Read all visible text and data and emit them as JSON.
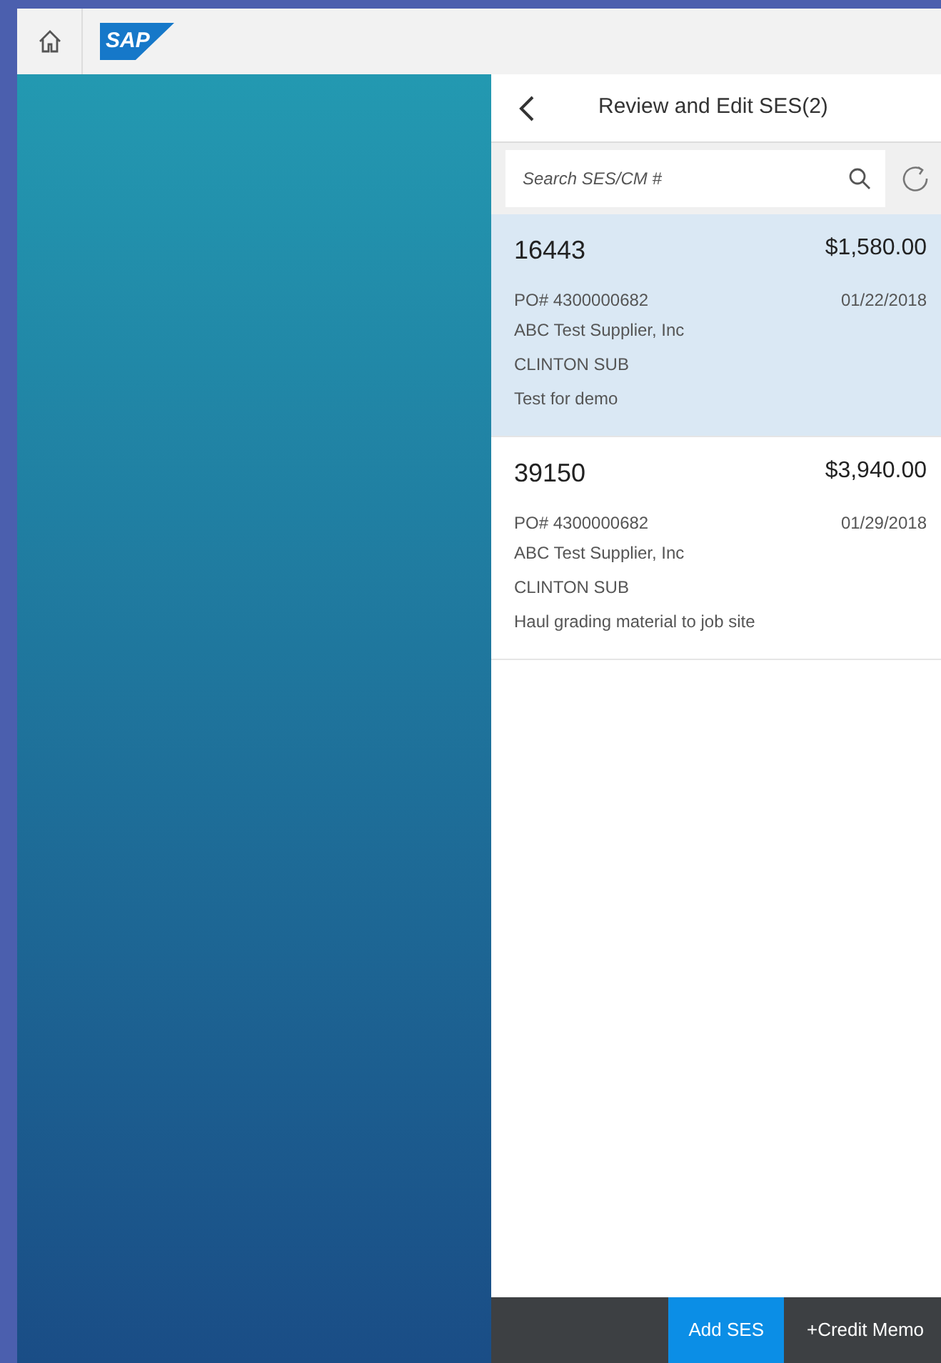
{
  "header": {
    "logo_text": "SAP"
  },
  "panel": {
    "title": "Review and Edit SES(2)",
    "search": {
      "placeholder": "Search SES/CM #"
    }
  },
  "items": [
    {
      "number": "16443",
      "amount": "$1,580.00",
      "po": "PO# 4300000682",
      "date": "01/22/2018",
      "supplier": "ABC Test Supplier, Inc",
      "site": "CLINTON SUB",
      "description": "Test for demo",
      "selected": true
    },
    {
      "number": "39150",
      "amount": "$3,940.00",
      "po": "PO# 4300000682",
      "date": "01/29/2018",
      "supplier": "ABC Test Supplier, Inc",
      "site": "CLINTON SUB",
      "description": "Haul grading material to job site",
      "selected": false
    }
  ],
  "footer": {
    "buttons": [
      "Add SES",
      "+Credit Memo"
    ]
  }
}
